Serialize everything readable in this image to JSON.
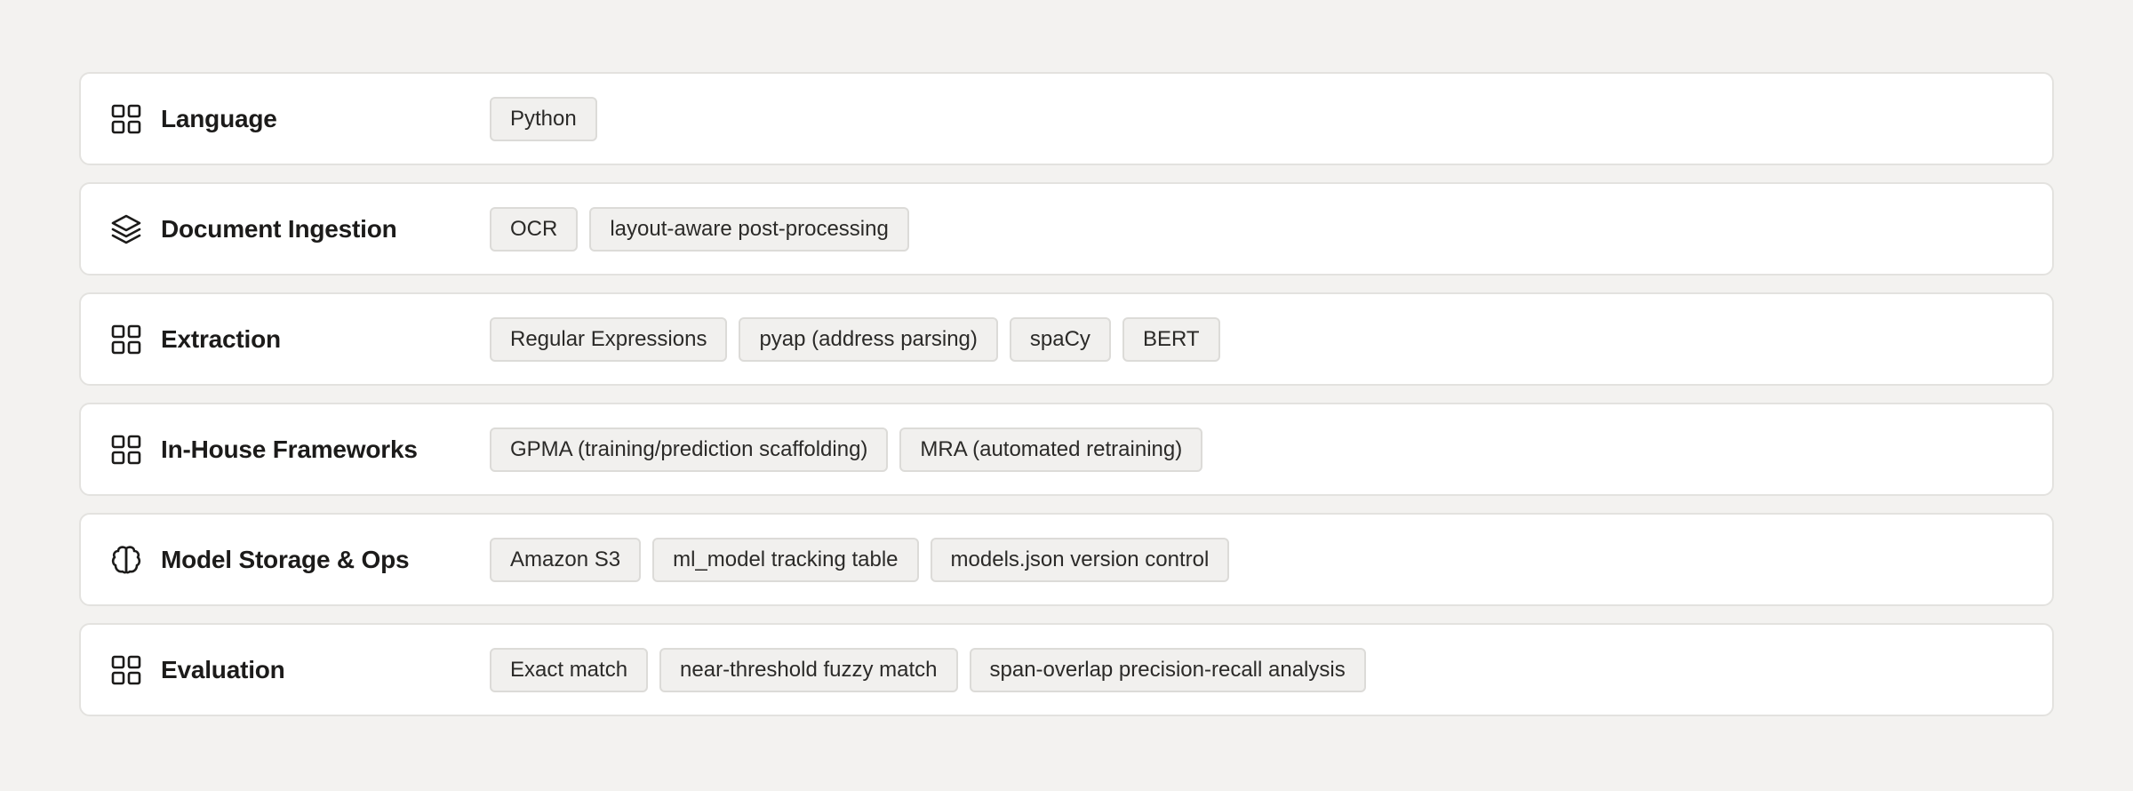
{
  "rows": [
    {
      "title": "Language",
      "icon": "grid-icon",
      "tags": [
        "Python"
      ]
    },
    {
      "title": "Document Ingestion",
      "icon": "layers-icon",
      "tags": [
        "OCR",
        "layout-aware post-processing"
      ]
    },
    {
      "title": "Extraction",
      "icon": "grid-icon",
      "tags": [
        "Regular Expressions",
        "pyap (address parsing)",
        "spaCy",
        "BERT"
      ]
    },
    {
      "title": "In-House Frameworks",
      "icon": "grid-icon",
      "tags": [
        "GPMA (training/prediction scaffolding)",
        "MRA (automated retraining)"
      ]
    },
    {
      "title": "Model Storage & Ops",
      "icon": "brain-icon",
      "tags": [
        "Amazon S3",
        "ml_model tracking table",
        "models.json version control"
      ]
    },
    {
      "title": "Evaluation",
      "icon": "grid-icon",
      "tags": [
        "Exact match",
        "near-threshold fuzzy match",
        "span-overlap precision-recall analysis"
      ]
    }
  ]
}
